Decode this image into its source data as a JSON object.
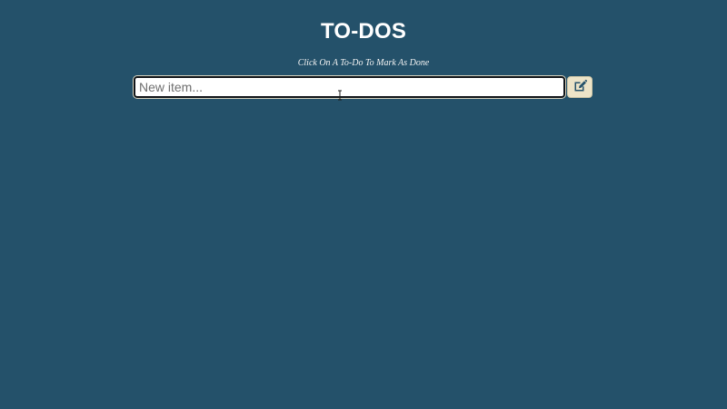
{
  "header": {
    "title": "TO-DOS",
    "subtitle": "Click On A To-Do To Mark As Done"
  },
  "new_item": {
    "placeholder": "New item...",
    "value": ""
  },
  "add_button": {
    "icon": "edit-icon"
  },
  "colors": {
    "background": "#24516a",
    "button_background": "#ede4c8",
    "icon": "#24516a",
    "text": "#ffffff"
  },
  "todos": []
}
